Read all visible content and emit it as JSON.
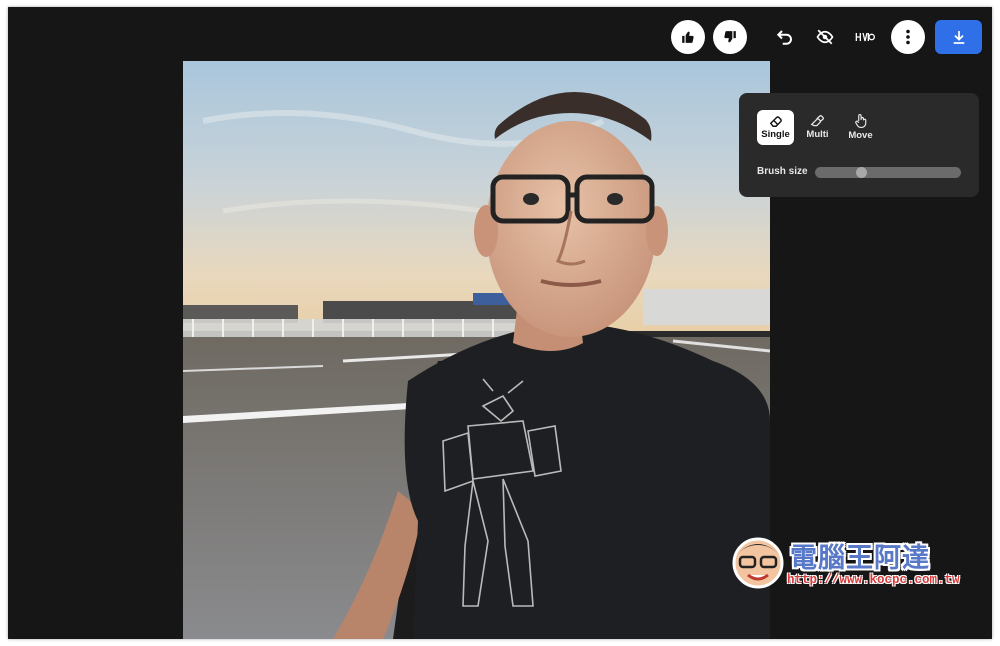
{
  "toolbar": {
    "like_icon": "thumbs-up-icon",
    "dislike_icon": "thumbs-down-icon",
    "undo_icon": "undo-icon",
    "hide_icon": "eye-off-icon",
    "compare_icon": "compare-icon",
    "more_icon": "more-vertical-icon",
    "download_icon": "download-icon",
    "accent_color": "#2f6fe8"
  },
  "brush_panel": {
    "modes": [
      {
        "label": "Single",
        "icon": "eraser-icon",
        "active": true
      },
      {
        "label": "Multi",
        "icon": "multi-eraser-icon",
        "active": false
      },
      {
        "label": "Move",
        "icon": "hand-pointer-icon",
        "active": false
      }
    ],
    "brush_size_label": "Brush size",
    "brush_size_value": 0.3
  },
  "watermark": {
    "title": "電腦王阿達",
    "url": "http://www.kocpc.com.tw"
  }
}
